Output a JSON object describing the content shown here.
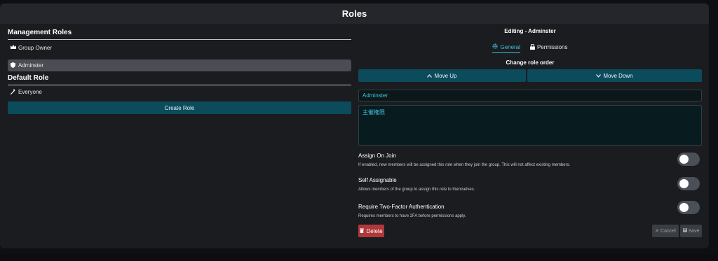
{
  "modal": {
    "title": "Roles"
  },
  "left": {
    "management_title": "Management Roles",
    "management_roles": [
      {
        "label": "Group Owner",
        "icon": "crown-icon"
      },
      {
        "label": "Adminster",
        "icon": "shield-icon",
        "selected": true
      }
    ],
    "default_title": "Default Role",
    "default_roles": [
      {
        "label": "Everyone",
        "icon": "magic-wand-icon"
      }
    ],
    "create_button": "Create Role"
  },
  "right": {
    "editing_title": "Editing - Adminster",
    "tabs": [
      {
        "label": "General",
        "icon": "gear-icon",
        "active": true
      },
      {
        "label": "Permissions",
        "icon": "lock-icon",
        "active": false
      }
    ],
    "order_label": "Change role order",
    "move_up": "Move Up",
    "move_down": "Move Down",
    "name_value": "Adminster",
    "description_value": "主催権限",
    "options": [
      {
        "title": "Assign On Join",
        "desc": "If enabled, new members will be assigned this role when they join the group. This will not affect existing members.",
        "enabled": false
      },
      {
        "title": "Self Assignable",
        "desc": "Allows members of the group to assign this role to themselves.",
        "enabled": false
      },
      {
        "title": "Require Two-Factor Authentication",
        "desc": "Requires members to have 2FA before permissions apply.",
        "enabled": false
      }
    ],
    "delete_button": "Delete",
    "cancel_button": "Cancel",
    "save_button": "Save"
  },
  "colors": {
    "accent": "#3fc3dc",
    "teal_button": "#0b4b5c",
    "danger": "#b0383b"
  }
}
